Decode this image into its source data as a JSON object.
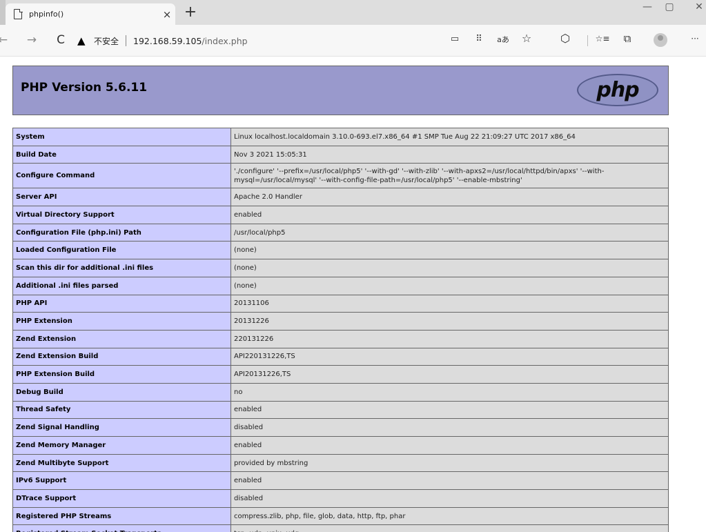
{
  "browser": {
    "tab_title": "phpinfo()",
    "tab_close": "×",
    "new_tab": "+",
    "window_controls": {
      "minimize": "—",
      "maximize": "▢",
      "close": "✕"
    },
    "nav": {
      "back": "←",
      "forward": "→",
      "reload": "C"
    },
    "security_label": "不安全",
    "url_host": "192.168.59.105",
    "url_path": "/index.php",
    "toolbar_icons": {
      "read": "▭",
      "apps": "⠿",
      "translate": "aあ",
      "favorite": "☆",
      "extension": "⬡",
      "favorites_bar": "☆≡",
      "collections": "⧉",
      "menu": "···"
    }
  },
  "page": {
    "heading": "PHP Version 5.6.11",
    "logo_text": "php",
    "rows": [
      {
        "name": "System",
        "value": "Linux localhost.localdomain 3.10.0-693.el7.x86_64 #1 SMP Tue Aug 22 21:09:27 UTC 2017 x86_64"
      },
      {
        "name": "Build Date",
        "value": "Nov 3 2021 15:05:31"
      },
      {
        "name": "Configure Command",
        "value": "'./configure' '--prefix=/usr/local/php5' '--with-gd' '--with-zlib' '--with-apxs2=/usr/local/httpd/bin/apxs' '--with-mysql=/usr/local/mysql' '--with-config-file-path=/usr/local/php5' '--enable-mbstring'"
      },
      {
        "name": "Server API",
        "value": "Apache 2.0 Handler"
      },
      {
        "name": "Virtual Directory Support",
        "value": "enabled"
      },
      {
        "name": "Configuration File (php.ini) Path",
        "value": "/usr/local/php5"
      },
      {
        "name": "Loaded Configuration File",
        "value": "(none)"
      },
      {
        "name": "Scan this dir for additional .ini files",
        "value": "(none)"
      },
      {
        "name": "Additional .ini files parsed",
        "value": "(none)"
      },
      {
        "name": "PHP API",
        "value": "20131106"
      },
      {
        "name": "PHP Extension",
        "value": "20131226"
      },
      {
        "name": "Zend Extension",
        "value": "220131226"
      },
      {
        "name": "Zend Extension Build",
        "value": "API220131226,TS"
      },
      {
        "name": "PHP Extension Build",
        "value": "API20131226,TS"
      },
      {
        "name": "Debug Build",
        "value": "no"
      },
      {
        "name": "Thread Safety",
        "value": "enabled"
      },
      {
        "name": "Zend Signal Handling",
        "value": "disabled"
      },
      {
        "name": "Zend Memory Manager",
        "value": "enabled"
      },
      {
        "name": "Zend Multibyte Support",
        "value": "provided by mbstring"
      },
      {
        "name": "IPv6 Support",
        "value": "enabled"
      },
      {
        "name": "DTrace Support",
        "value": "disabled"
      },
      {
        "name": "Registered PHP Streams",
        "value": "compress.zlib, php, file, glob, data, http, ftp, phar"
      },
      {
        "name": "Registered Stream Socket Transports",
        "value": "tcp, udp, unix, udg"
      }
    ]
  },
  "colors": {
    "header_bg": "#9999cc",
    "label_bg": "#ccccff",
    "value_bg": "#dcdcdc"
  }
}
